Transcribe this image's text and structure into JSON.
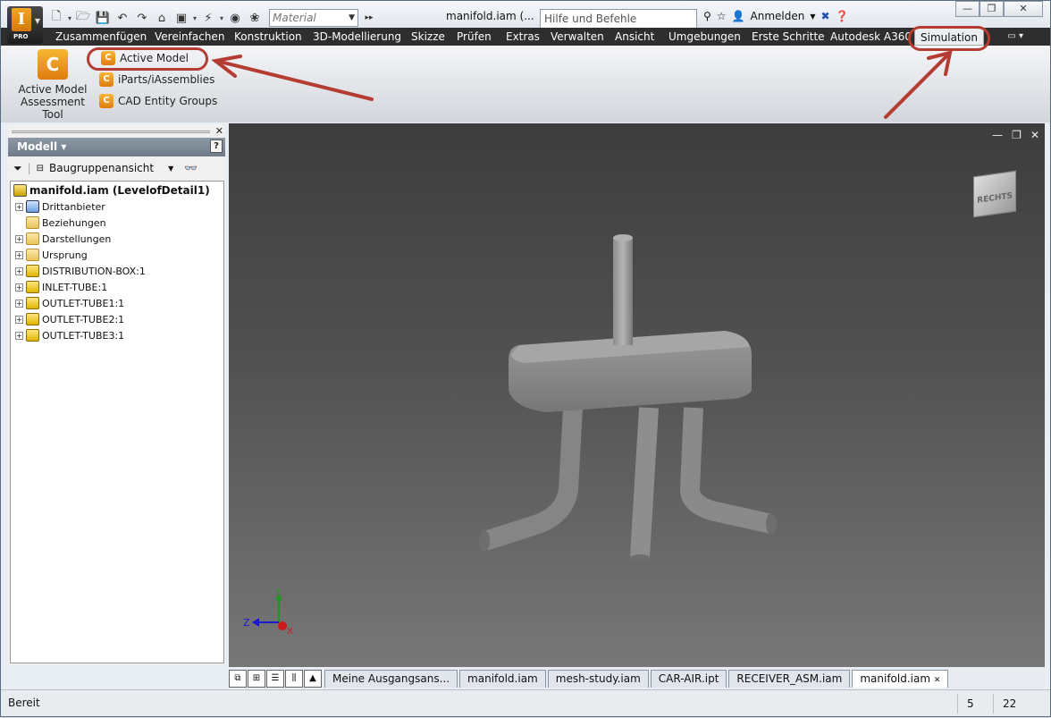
{
  "app": {
    "logo_letter": "I",
    "edition": "PRO"
  },
  "title": {
    "document": "manifold.iam (...",
    "search_placeholder": "Hilfe und Befehle durchsuchen...",
    "signin": "Anmelden"
  },
  "qat": {
    "material": "Material"
  },
  "tabs": [
    {
      "label": "Zusammenfügen"
    },
    {
      "label": "Vereinfachen"
    },
    {
      "label": "Konstruktion"
    },
    {
      "label": "3D-Modellierung"
    },
    {
      "label": "Skizze"
    },
    {
      "label": "Prüfen"
    },
    {
      "label": "Extras"
    },
    {
      "label": "Verwalten"
    },
    {
      "label": "Ansicht"
    },
    {
      "label": "Umgebungen"
    },
    {
      "label": "Erste Schritte"
    },
    {
      "label": "Autodesk A360"
    },
    {
      "label": "Simulation"
    }
  ],
  "ribbon": {
    "big_tool": {
      "line1": "Active Model",
      "line2": "Assessment Tool"
    },
    "small_tools": [
      {
        "label": "Active Model"
      },
      {
        "label": "iParts/iAssemblies"
      },
      {
        "label": "CAD Entity Groups"
      }
    ]
  },
  "browser": {
    "title": "Modell",
    "view_select": "Baugruppenansicht",
    "root": "manifold.iam (LevelofDetail1)",
    "nodes": [
      {
        "label": "Drittanbieter"
      },
      {
        "label": "Beziehungen"
      },
      {
        "label": "Darstellungen"
      },
      {
        "label": "Ursprung"
      },
      {
        "label": "DISTRIBUTION-BOX:1"
      },
      {
        "label": "INLET-TUBE:1"
      },
      {
        "label": "OUTLET-TUBE1:1"
      },
      {
        "label": "OUTLET-TUBE2:1"
      },
      {
        "label": "OUTLET-TUBE3:1"
      }
    ]
  },
  "viewcube": {
    "face": "RECHTS"
  },
  "triad": {
    "x": "X",
    "y": "Y",
    "z": "Z"
  },
  "doc_tabs": [
    {
      "label": "Meine Ausgangsans..."
    },
    {
      "label": "manifold.iam"
    },
    {
      "label": "mesh-study.iam"
    },
    {
      "label": "CAR-AIR.ipt"
    },
    {
      "label": "RECEIVER_ASM.iam"
    },
    {
      "label": "manifold.iam"
    }
  ],
  "status": {
    "text": "Bereit",
    "count1": "5",
    "count2": "22"
  },
  "colors": {
    "highlight_ring": "#b43c32",
    "tab_bar": "#2e2e2e"
  }
}
